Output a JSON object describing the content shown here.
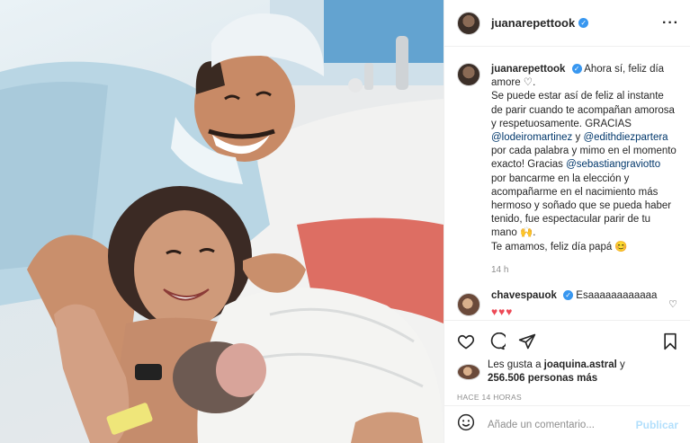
{
  "post": {
    "author": "juanarepettook",
    "author_verified": true,
    "more_icon": "more-options-icon"
  },
  "caption": {
    "username": "juanarepettook",
    "line1": "Ahora sí, feliz día amore ♡.",
    "text_a": "Se puede estar así de feliz al instante de parir cuando te acompañan amorosa y respetuosamente. GRACIAS ",
    "mention1": "@lodeiromartinez",
    "text_b": " y ",
    "mention2": "@edithdiezpartera",
    "text_c": " por cada palabra y mimo en el momento exacto! Gracias ",
    "mention3": "@sebastiangraviotto",
    "text_d": " por bancarme en la elección y acompañarme en el nacimiento más hermoso y soñado que se pueda haber tenido, fue espectacular parir de tu mano 🙌.",
    "line_last": "Te amamos, feliz día papá 😊",
    "age": "14 h"
  },
  "reply": {
    "username": "chavespauok",
    "verified": true,
    "text": "Esaaaaaaaaaaaa",
    "hearts": "♥♥♥"
  },
  "actions": {
    "icons": [
      "heart-icon",
      "comment-icon",
      "share-icon",
      "bookmark-icon"
    ]
  },
  "likes": {
    "prefix": "Les gusta a ",
    "first_user": "joaquina.astral",
    "joiner": " y",
    "count": "256.506 personas más"
  },
  "timestamp": "HACE 14 HORAS",
  "composer": {
    "emoji_icon": "emoji-icon",
    "placeholder": "Añade un comentario...",
    "publish_label": "Publicar"
  },
  "colors": {
    "verified_blue": "#3897f0",
    "mention_blue": "#00376b",
    "publish_disabled": "#b2dffc",
    "heart_red": "#ed4956"
  }
}
